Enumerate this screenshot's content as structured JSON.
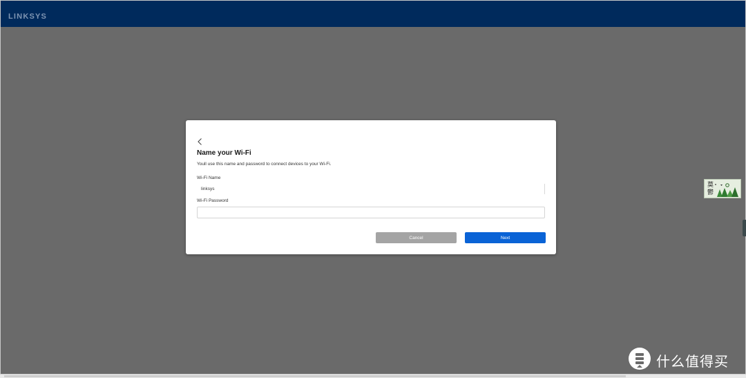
{
  "header": {
    "logo": "LINKSYS",
    "background_color": "#002a5c"
  },
  "dialog": {
    "back_icon": "chevron-left-icon",
    "title": "Name your Wi-Fi",
    "description": "Youll use this name and password to connect devices to your Wi-Fi.",
    "wifi_name_label": "Wi-Fi Name",
    "wifi_name_value": "linksys",
    "wifi_password_label": "Wi-Fi Password",
    "wifi_password_value": "",
    "cancel_label": "Cancel",
    "next_label": "Next"
  },
  "colors": {
    "overlay": "#6a6a6a",
    "primary_button": "#0a63d6",
    "secondary_button": "#a4a4a4"
  },
  "side_widget": {
    "glyph_top": "莫",
    "glyph_bottom": "鬱",
    "icon": "pine-trees-icon"
  },
  "watermark": {
    "icon": "smzdm-logo-icon",
    "text": "什么值得买"
  }
}
